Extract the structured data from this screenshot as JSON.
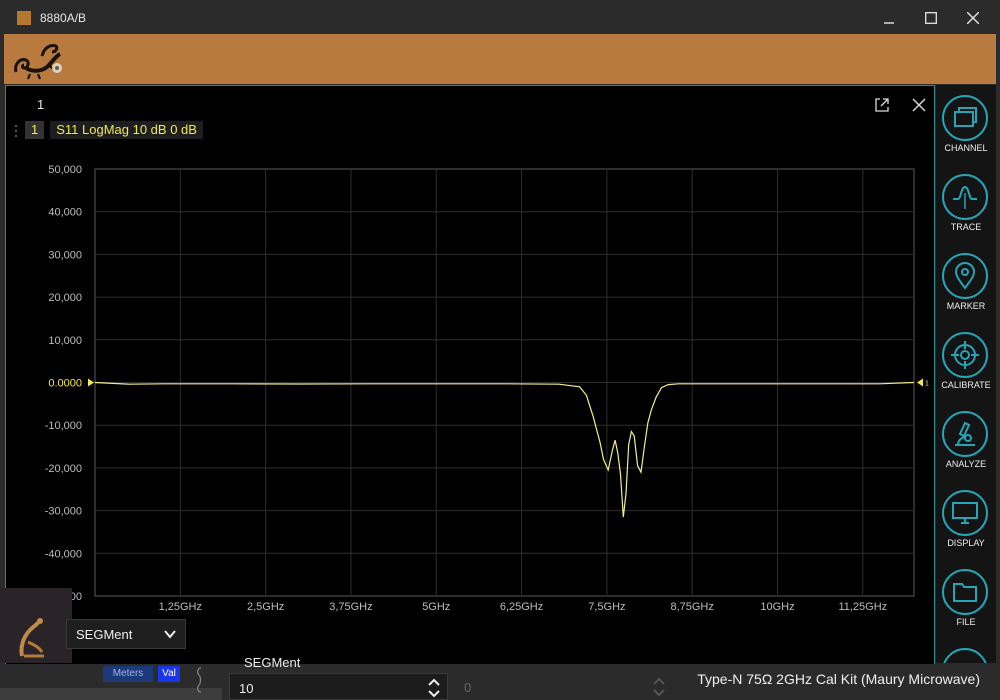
{
  "window": {
    "title": "8880A/B"
  },
  "channel": {
    "number": "1",
    "trace_label": {
      "number": "1",
      "text": "S11 LogMag 10 dB 0 dB"
    }
  },
  "chart_data": {
    "type": "line",
    "title": "",
    "xlabel": "",
    "ylabel": "",
    "x_unit": "GHz",
    "xlim": [
      0,
      12.0
    ],
    "ylim": [
      -50000,
      50000
    ],
    "x_tick_labels": [
      "1,25GHz",
      "2,5GHz",
      "3,75GHz",
      "5GHz",
      "6,25GHz",
      "7,5GHz",
      "8,75GHz",
      "10GHz",
      "11,25GHz"
    ],
    "x_ticks": [
      1.25,
      2.5,
      3.75,
      5.0,
      6.25,
      7.5,
      8.75,
      10.0,
      11.25
    ],
    "y_tick_labels": [
      "50,000",
      "40,000",
      "30,000",
      "20,000",
      "10,000",
      "0.0000",
      "-10,000",
      "-20,000",
      "-30,000",
      "-40,000",
      "-50,000"
    ],
    "y_ticks": [
      50000,
      40000,
      30000,
      20000,
      10000,
      0,
      -10000,
      -20000,
      -30000,
      -40000,
      -50000
    ],
    "reference_level": 0,
    "reference_marker_label": "1",
    "grid": true,
    "series": [
      {
        "color": "#f4ef8c",
        "x": [
          0,
          0.5,
          1,
          2,
          3,
          4,
          5,
          6,
          6.8,
          7.1,
          7.2,
          7.3,
          7.4,
          7.45,
          7.52,
          7.58,
          7.62,
          7.66,
          7.7,
          7.74,
          7.78,
          7.82,
          7.86,
          7.9,
          7.95,
          8.0,
          8.05,
          8.1,
          8.15,
          8.22,
          8.3,
          8.4,
          8.55,
          8.8,
          9.5,
          10.5,
          11.5,
          12.0
        ],
        "y": [
          0,
          -400,
          -300,
          -300,
          -350,
          -300,
          -300,
          -300,
          -400,
          -1000,
          -3000,
          -8000,
          -14000,
          -18000,
          -20500,
          -16000,
          -13500,
          -16500,
          -21500,
          -31500,
          -26000,
          -14500,
          -11500,
          -12500,
          -19500,
          -21000,
          -15000,
          -9500,
          -6500,
          -3500,
          -1200,
          -500,
          -300,
          -300,
          -300,
          -300,
          -300,
          0
        ]
      }
    ]
  },
  "sidebar": {
    "items": [
      {
        "label": "CHANNEL",
        "icon": "channel-icon"
      },
      {
        "label": "TRACE",
        "icon": "trace-icon"
      },
      {
        "label": "MARKER",
        "icon": "marker-icon"
      },
      {
        "label": "CALIBRATE",
        "icon": "calibrate-icon"
      },
      {
        "label": "ANALYZE",
        "icon": "analyze-icon"
      },
      {
        "label": "DISPLAY",
        "icon": "display-icon"
      },
      {
        "label": "FILE",
        "icon": "file-icon"
      }
    ]
  },
  "controls": {
    "segment_select": "SEGMent",
    "segment_label": "SEGMent",
    "segment_value": "10",
    "secondary_value": "0",
    "meters_label": "Meters",
    "val_label": "Val"
  },
  "status": {
    "cal_kit": "Type-N 75Ω 2GHz Cal Kit (Maury Microwave)"
  },
  "colors": {
    "accent": "#26a5b6",
    "banner": "#b87a3e",
    "trace": "#f4ef8c",
    "trace_label": "#f2e94b"
  }
}
